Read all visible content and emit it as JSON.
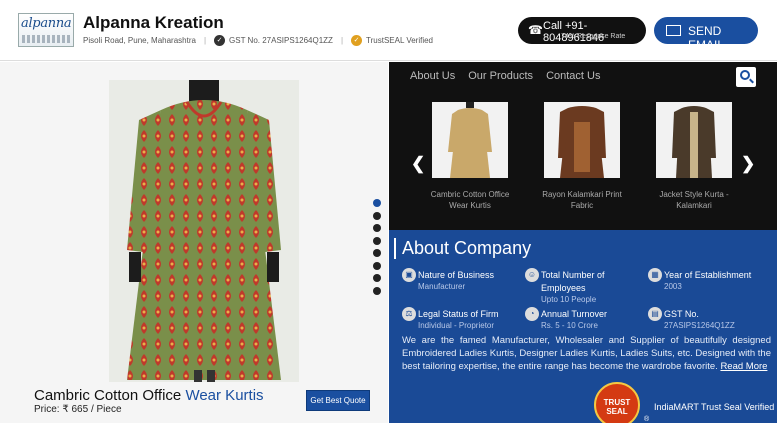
{
  "header": {
    "logo_text": "alpanna",
    "company_name": "Alpanna Kreation",
    "location": "Pisoli Road, Pune, Maharashtra",
    "gst": "GST No. 27ASIPS1264Q1ZZ",
    "trustseal": "TrustSEAL Verified",
    "call_label": "Call +91-8048961846",
    "call_rate": "74% Response Rate",
    "email_label": "SEND EMAIL"
  },
  "nav": {
    "items": [
      "About Us",
      "Our Products",
      "Contact Us"
    ]
  },
  "product": {
    "title_main": "Cambric Cotton Office",
    "title_highlight": "Wear Kurtis",
    "price": "Price: ₹ 665 / Piece",
    "quote_label": "Get Best Quote"
  },
  "thumbnails": [
    {
      "label": "Cambric Cotton Office Wear Kurtis"
    },
    {
      "label": "Rayon Kalamkari Print Fabric"
    },
    {
      "label": "Jacket Style Kurta - Kalamkari"
    }
  ],
  "about": {
    "title": "About Company",
    "facts": [
      {
        "label": "Nature of Business",
        "value": "Manufacturer",
        "icon": "building-icon"
      },
      {
        "label": "Total Number of Employees",
        "value": "Upto 10 People",
        "icon": "employees-icon"
      },
      {
        "label": "Year of Establishment",
        "value": "2003",
        "icon": "calendar-icon"
      },
      {
        "label": "Legal Status of Firm",
        "value": "Individual - Proprietor",
        "icon": "legal-icon"
      },
      {
        "label": "Annual Turnover",
        "value": "Rs. 5 - 10 Crore",
        "icon": "turnover-icon"
      },
      {
        "label": "GST No.",
        "value": "27ASIPS1264Q1ZZ",
        "icon": "gst-icon"
      }
    ],
    "description": "We are the famed Manufacturer, Wholesaler and Supplier of beautifully designed Embroidered Ladies Kurtis, Designer Ladies Kurtis, Ladies Suits, etc. Designed with the best tailoring expertise, the entire range has become the wardrobe favorite.",
    "read_more": "Read More",
    "seal_text": "TRUST SEAL",
    "trust_verified": "IndiaMART Trust Seal Verified",
    "registered": "®"
  },
  "colors": {
    "brand_blue": "#1a4fa0",
    "about_bg": "#1a4a96",
    "dark_bg": "#111111",
    "kurta_green": "#7a8f4a",
    "kurta_red": "#c0392b"
  },
  "slider": {
    "count": 8,
    "active": 1
  }
}
